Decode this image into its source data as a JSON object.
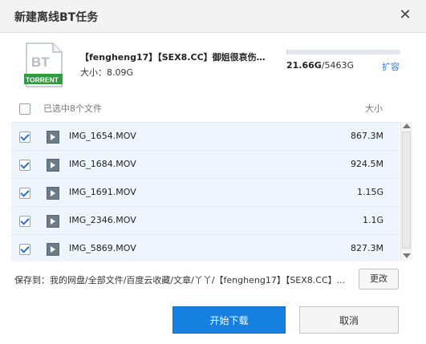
{
  "dialog": {
    "title": "新建离线BT任务",
    "close_icon": "close-icon"
  },
  "task": {
    "icon_name": "bt-torrent-file-icon",
    "icon_top_text": "BT",
    "icon_bottom_text": "TORRENT",
    "name": "【fengheng17】【SEX8.CC】御姐很哀伤…",
    "size_label": "大小：",
    "size_value": "8.09G"
  },
  "quota": {
    "used": "21.66G",
    "total": "/5463G",
    "used_fraction": 0.004,
    "expand_label": "扩容"
  },
  "list_header": {
    "selected_label": "已选中8个文件",
    "size_label": "大小"
  },
  "files": [
    {
      "name": "IMG_1654.MOV",
      "size": "867.3M",
      "checked": true
    },
    {
      "name": "IMG_1684.MOV",
      "size": "924.5M",
      "checked": true
    },
    {
      "name": "IMG_1691.MOV",
      "size": "1.15G",
      "checked": true
    },
    {
      "name": "IMG_2346.MOV",
      "size": "1.1G",
      "checked": true
    },
    {
      "name": "IMG_5869.MOV",
      "size": "827.3M",
      "checked": true
    }
  ],
  "save": {
    "label": "保存到：",
    "path": "我的网盘/全部文件/百度云收藏/文章/丫丫/【fengheng17】【SEX8.CC】...",
    "change_label": "更改"
  },
  "buttons": {
    "start": "开始下载",
    "cancel": "取消"
  },
  "colors": {
    "accent": "#1580e0",
    "row_bg": "#eef5fd",
    "link": "#3a7ad6",
    "icon_green": "#2f9a3e"
  }
}
